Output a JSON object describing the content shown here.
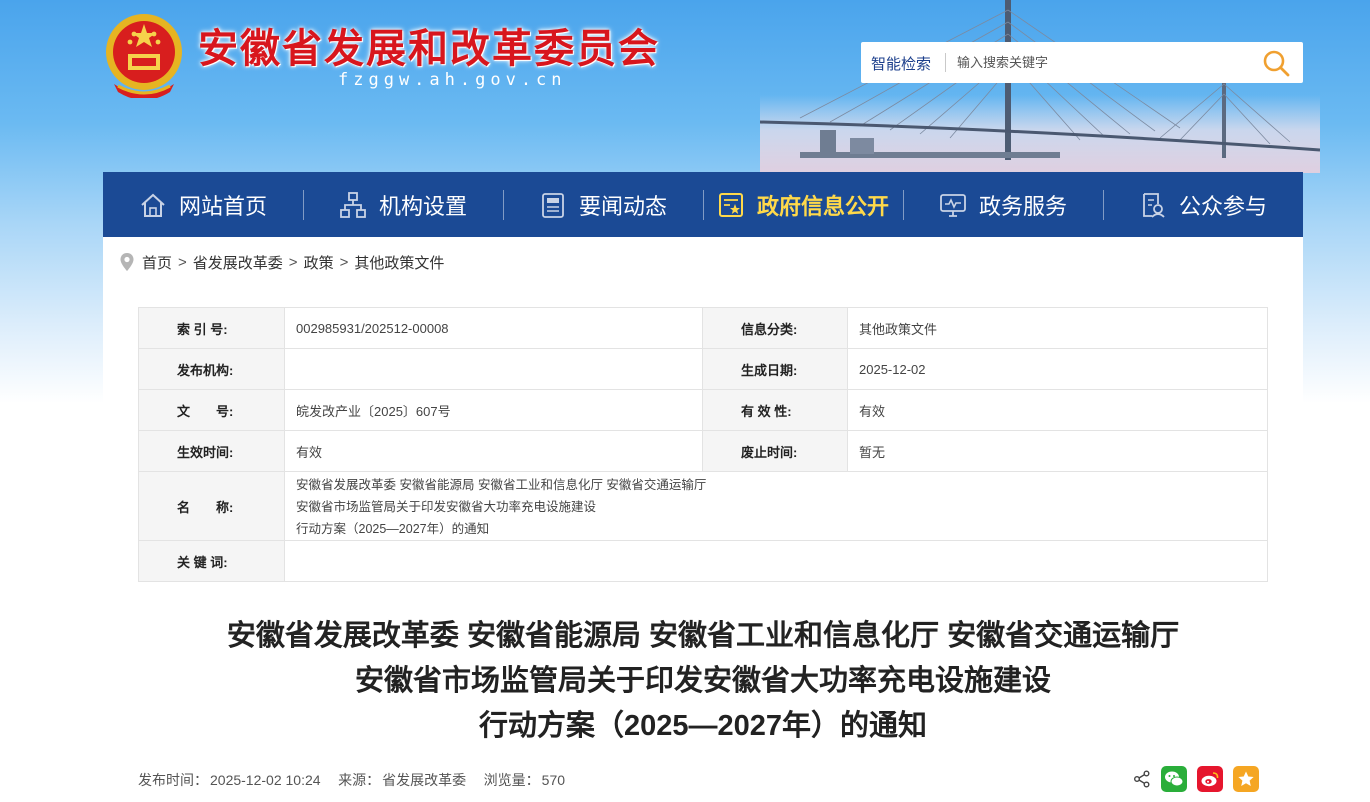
{
  "header": {
    "site_title": "安徽省发展和改革委员会",
    "site_domain": "fzggw.ah.gov.cn",
    "emblem_icon": "national-emblem-icon",
    "colors": {
      "title_red": "#d8161d",
      "nav_bg": "#1b4a95",
      "nav_active": "#ffd94a",
      "search_icon": "#f0a030"
    }
  },
  "search": {
    "label": "智能检索",
    "placeholder": "输入搜索关键字",
    "icon": "search-icon"
  },
  "nav": {
    "items": [
      {
        "label": "网站首页",
        "icon": "home-icon",
        "active": false
      },
      {
        "label": "机构设置",
        "icon": "org-chart-icon",
        "active": false
      },
      {
        "label": "要闻动态",
        "icon": "news-icon",
        "active": false
      },
      {
        "label": "政府信息公开",
        "icon": "info-disclosure-icon",
        "active": true
      },
      {
        "label": "政务服务",
        "icon": "monitor-icon",
        "active": false
      },
      {
        "label": "公众参与",
        "icon": "participation-icon",
        "active": false
      }
    ]
  },
  "breadcrumb": {
    "icon": "location-pin-icon",
    "items": [
      "首页",
      "省发展改革委",
      "政策",
      "其他政策文件"
    ],
    "separator": ">"
  },
  "info_table": {
    "index_label": "索 引 号:",
    "index_value": "002985931/202512-00008",
    "category_label": "信息分类:",
    "category_value": "其他政策文件",
    "publisher_label": "发布机构:",
    "publisher_value": "",
    "created_label": "生成日期:",
    "created_value": "2025-12-02",
    "docno_label": "文　　号:",
    "docno_value": "皖发改产业〔2025〕607号",
    "validity_label": "有 效 性:",
    "validity_value": "有效",
    "effective_label": "生效时间:",
    "effective_value": "有效",
    "abolish_label": "废止时间:",
    "abolish_value": "暂无",
    "name_label": "名　　称:",
    "name_lines": [
      "安徽省发展改革委 安徽省能源局 安徽省工业和信息化厅 安徽省交通运输厅",
      "安徽省市场监管局关于印发安徽省大功率充电设施建设",
      "行动方案（2025—2027年）的通知"
    ],
    "keywords_label": "关 键 词:",
    "keywords_value": ""
  },
  "document": {
    "title_lines": [
      "安徽省发展改革委 安徽省能源局 安徽省工业和信息化厅 安徽省交通运输厅",
      "安徽省市场监管局关于印发安徽省大功率充电设施建设",
      "行动方案（2025—2027年）的通知"
    ]
  },
  "meta": {
    "publish_label": "发布时间：",
    "publish_time": "2025-12-02 10:24",
    "source_label": "来源：",
    "source": "省发展改革委",
    "views_label": "浏览量：",
    "views": "570"
  },
  "share": {
    "icons": [
      "share-icon",
      "wechat-icon",
      "weibo-icon",
      "favorite-star-icon"
    ],
    "colors": {
      "wechat": "#2aae3a",
      "weibo": "#e6162d",
      "favorite": "#f5a623"
    }
  }
}
